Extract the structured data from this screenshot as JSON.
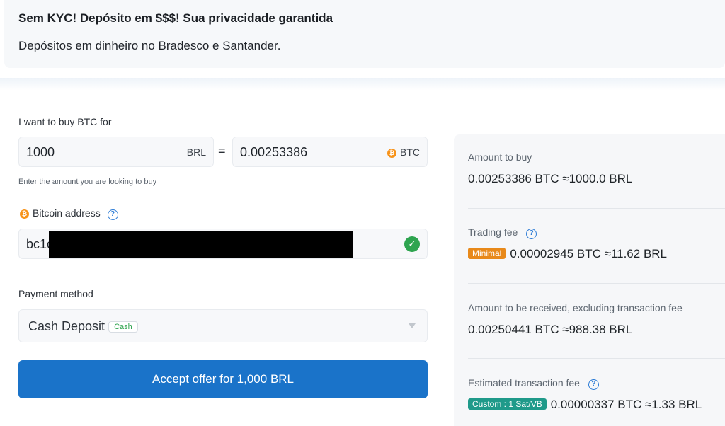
{
  "banner": {
    "title": "Sem KYC! Depósito em $$$! Sua privacidade garantida",
    "subtitle": "Depósitos em dinheiro no Bradesco e Santander."
  },
  "form": {
    "buy_label": "I want to buy BTC for",
    "fiat_amount": "1000",
    "fiat_unit": "BRL",
    "equals": "=",
    "btc_amount": "0.00253386",
    "btc_unit": "BTC",
    "helper": "Enter the amount you are looking to buy",
    "address_label": "Bitcoin address",
    "address_value": "bc1c",
    "payment_label": "Payment method",
    "payment_value": "Cash Deposit",
    "payment_badge": "Cash",
    "accept_label": "Accept offer for 1,000 BRL"
  },
  "summary": {
    "amount_label": "Amount to buy",
    "amount_value": "0.00253386 BTC ≈1000.0 BRL",
    "fee_label": "Trading fee",
    "fee_badge": "Minimal",
    "fee_value": "0.00002945 BTC ≈11.62 BRL",
    "received_label": "Amount to be received, excluding transaction fee",
    "received_value": "0.00250441 BTC ≈988.38 BRL",
    "tx_label": "Estimated transaction fee",
    "tx_badge": "Custom : 1 Sat/VB",
    "tx_value": "0.00000337 BTC ≈1.33 BRL"
  },
  "icons": {
    "btc": "bitcoin-icon",
    "help": "question-circle-icon",
    "valid": "check-circle-icon",
    "dropdown": "caret-down-icon"
  },
  "colors": {
    "accent": "#1a73c9",
    "bitcoin": "#f7931a",
    "success": "#2ea44f",
    "minimal_badge": "#e8891a",
    "custom_badge": "#1f9a8a"
  }
}
